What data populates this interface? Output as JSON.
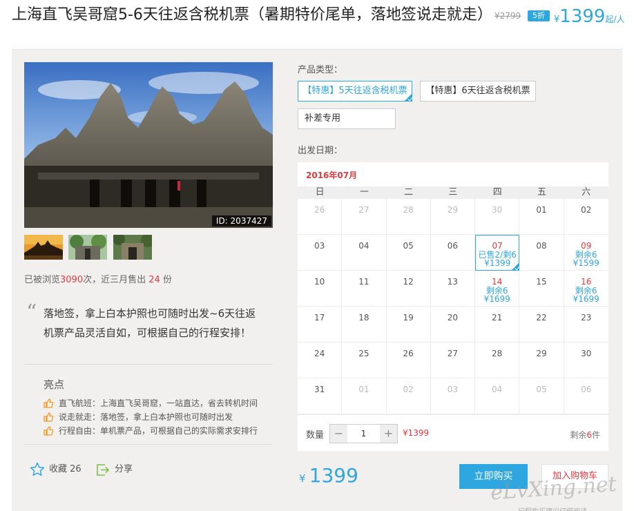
{
  "header": {
    "title": "上海直飞吴哥窟5-6天往返含税机票（暑期特价尾单，落地签说走就走）",
    "original_price": "¥2799",
    "discount_badge": "5折",
    "price_currency": "¥",
    "price_value": "1399",
    "price_unit": "起/人"
  },
  "gallery": {
    "image_id": "ID: 2037427",
    "thumbnail_count": 3
  },
  "stats": {
    "views_prefix": "已被浏览",
    "views_count": "3090",
    "views_mid": "次，近三月售出",
    "sold_count": "24",
    "sold_unit": "份"
  },
  "description": {
    "quote_mark": "“",
    "quote": "落地签，拿上白本护照也可随时出发~6天往返机票产品灵活自如，可根据自己的行程安排！"
  },
  "highlights": {
    "title": "亮点",
    "items": [
      "直飞航班：上海直飞吴哥窟，一站直达，省去转机时间",
      "说走就走：落地签，拿上白本护照也可随时出发",
      "行程自由：单机票产品，可根据自己的实际需求安排行"
    ]
  },
  "actions": {
    "favorite_label": "收藏 26",
    "share_label": "分享"
  },
  "product_type": {
    "label": "产品类型：",
    "options": [
      "【特惠】5天往返含税机票",
      "【特惠】6天往返含税机票",
      "补差专用"
    ],
    "selected_index": 0
  },
  "departure": {
    "label": "出发日期：",
    "month": "2016年07月",
    "weekdays": [
      "日",
      "一",
      "二",
      "三",
      "四",
      "五",
      "六"
    ],
    "weeks": [
      [
        {
          "d": "26",
          "o": true
        },
        {
          "d": "27",
          "o": true
        },
        {
          "d": "28",
          "o": true
        },
        {
          "d": "29",
          "o": true
        },
        {
          "d": "30",
          "o": true
        },
        {
          "d": "01"
        },
        {
          "d": "02"
        }
      ],
      [
        {
          "d": "03"
        },
        {
          "d": "04"
        },
        {
          "d": "05"
        },
        {
          "d": "06"
        },
        {
          "d": "07",
          "a": true,
          "s": "已售2/剩6",
          "p": "¥1399",
          "sel": true
        },
        {
          "d": "08"
        },
        {
          "d": "09",
          "a": true,
          "s": "剩余6",
          "p": "¥1599"
        }
      ],
      [
        {
          "d": "10"
        },
        {
          "d": "11"
        },
        {
          "d": "12"
        },
        {
          "d": "13"
        },
        {
          "d": "14",
          "a": true,
          "s": "剩余6",
          "p": "¥1699"
        },
        {
          "d": "15"
        },
        {
          "d": "16",
          "a": true,
          "s": "剩余6",
          "p": "¥1699"
        }
      ],
      [
        {
          "d": "17"
        },
        {
          "d": "18"
        },
        {
          "d": "19"
        },
        {
          "d": "20"
        },
        {
          "d": "21"
        },
        {
          "d": "22"
        },
        {
          "d": "23"
        }
      ],
      [
        {
          "d": "24"
        },
        {
          "d": "25"
        },
        {
          "d": "26"
        },
        {
          "d": "27"
        },
        {
          "d": "28"
        },
        {
          "d": "29"
        },
        {
          "d": "30"
        }
      ],
      [
        {
          "d": "31"
        },
        {
          "d": "01",
          "o": true
        },
        {
          "d": "02",
          "o": true
        },
        {
          "d": "03",
          "o": true
        },
        {
          "d": "04",
          "o": true
        },
        {
          "d": "05",
          "o": true
        },
        {
          "d": "06",
          "o": true
        }
      ]
    ]
  },
  "quantity": {
    "label": "数量",
    "minus": "−",
    "plus": "+",
    "value": "1",
    "total": "¥1399",
    "remaining_prefix": "剩余",
    "remaining_count": "6",
    "remaining_unit": "件"
  },
  "purchase": {
    "currency": "¥",
    "price": "1399",
    "buy_now": "立即购买",
    "add_to_cart": "加入购物车",
    "note": "行程购买建议仔细阅读"
  },
  "watermark": "eLvXing.net",
  "colors": {
    "accent": "#2ea7e0",
    "highlight_red": "#e4393c",
    "panel_bg": "#f1f0ee",
    "icon_orange": "#f39a1e",
    "share_green": "#7cbf3f"
  }
}
